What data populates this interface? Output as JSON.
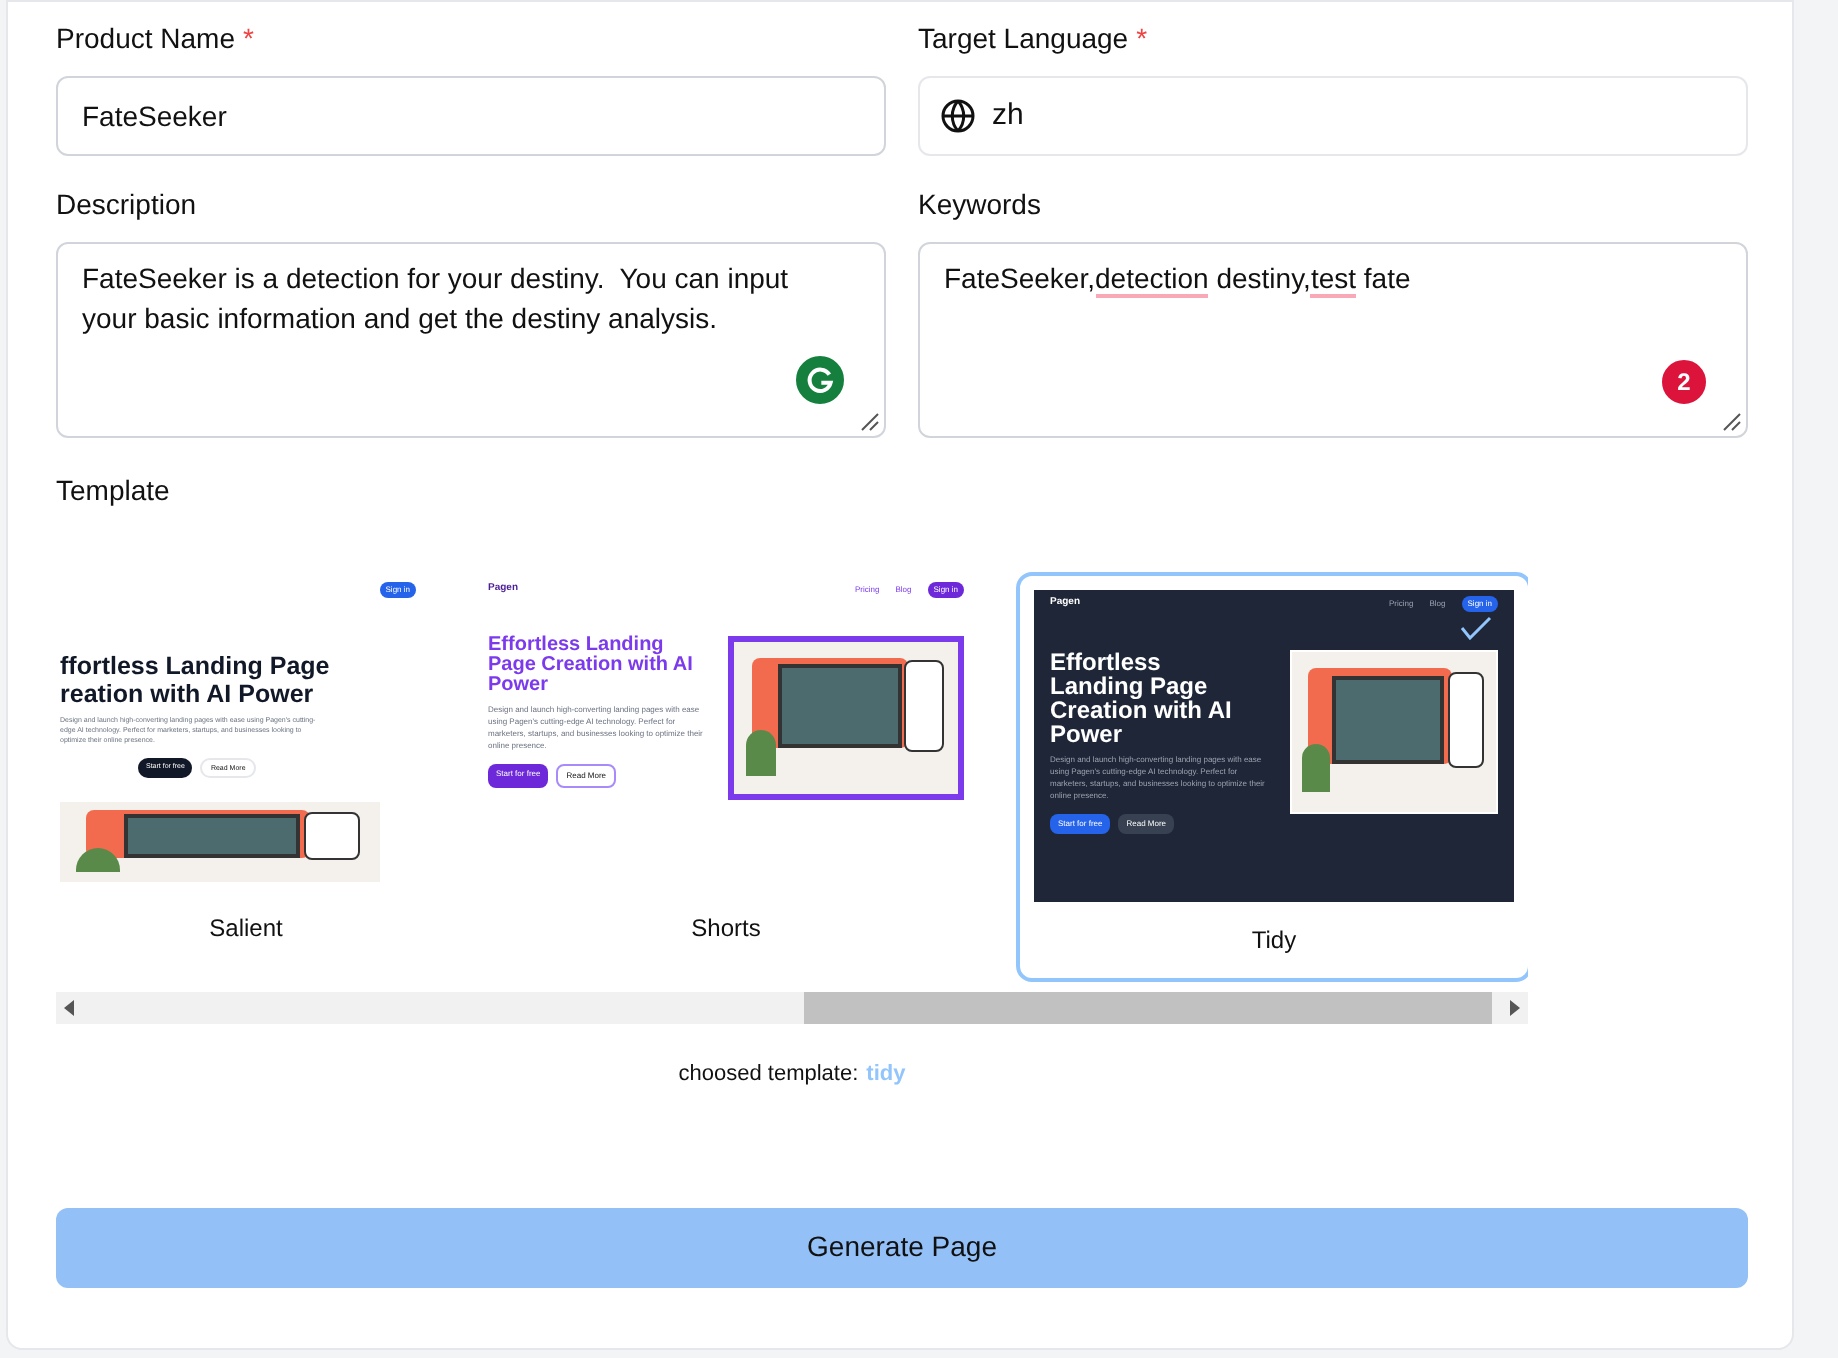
{
  "product_name": {
    "label": "Product Name",
    "required_mark": "*",
    "value": "FateSeeker"
  },
  "target_language": {
    "label": "Target Language",
    "required_mark": "*",
    "value": "zh"
  },
  "description": {
    "label": "Description",
    "value": "FateSeeker is a detection for your destiny.  You can input your basic information and get the destiny analysis."
  },
  "keywords": {
    "label": "Keywords",
    "segments": [
      {
        "text": "FateSeeker,",
        "flagged": false
      },
      {
        "text": "detection",
        "flagged": true
      },
      {
        "text": " destiny,",
        "flagged": false
      },
      {
        "text": "test",
        "flagged": true
      },
      {
        "text": " fate",
        "flagged": false
      }
    ],
    "badge": "2"
  },
  "template": {
    "label": "Template",
    "items": [
      {
        "name": "Salient",
        "kind": "light",
        "selected": false,
        "nav": [
          "Sign in"
        ],
        "headline": [
          "ffortless Landing Page",
          "reation with AI Power"
        ],
        "text": "Design and launch high-converting landing pages with ease using Pagen's cutting-edge AI technology. Perfect for marketers, startups, and businesses looking to optimize their online presence.",
        "buttons": [
          "Start for free",
          "Read More"
        ]
      },
      {
        "name": "Shorts",
        "kind": "purple",
        "selected": false,
        "logo": "Pagen",
        "nav": [
          "Pricing",
          "Blog",
          "Sign in"
        ],
        "headline": [
          "Effortless Landing",
          "Page Creation with AI",
          "Power"
        ],
        "text": "Design and launch high-converting landing pages with ease using Pagen's cutting-edge AI technology. Perfect for marketers, startups, and businesses looking to optimize their online presence.",
        "buttons": [
          "Start for free",
          "Read More"
        ]
      },
      {
        "name": "Tidy",
        "kind": "dark",
        "selected": true,
        "logo": "Pagen",
        "nav": [
          "Pricing",
          "Blog",
          "Sign in"
        ],
        "headline": [
          "Effortless",
          "Landing Page",
          "Creation with AI",
          "Power"
        ],
        "text": "Design and launch high-converting landing pages with ease using Pagen's cutting-edge AI technology. Perfect for marketers, startups, and businesses looking to optimize their online presence.",
        "buttons": [
          "Start for free",
          "Read More"
        ]
      }
    ],
    "chosen_label": "choosed template:",
    "chosen_value": "tidy"
  },
  "generate_button": "Generate Page"
}
